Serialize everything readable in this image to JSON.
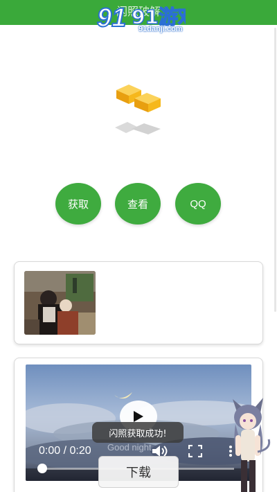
{
  "header": {
    "title": "闪照破解"
  },
  "watermark": {
    "logo_text": "91游戏",
    "site": "91danji.com"
  },
  "buttons": {
    "get": "获取",
    "view": "查看",
    "qq": "QQ"
  },
  "video": {
    "time": "0:00 / 0:20",
    "caption": "Good night.",
    "progress": 0.0
  },
  "toast": {
    "message": "闪照获取成功!"
  },
  "download": {
    "label": "下载"
  },
  "colors": {
    "primary": "#3aa93a",
    "logo_yellow": "#f3b81f",
    "shadow_grey": "#d7d7d7"
  },
  "icons": {
    "play": "play-icon",
    "volume": "volume-icon",
    "fullscreen": "fullscreen-icon",
    "more": "more-vert-icon"
  }
}
